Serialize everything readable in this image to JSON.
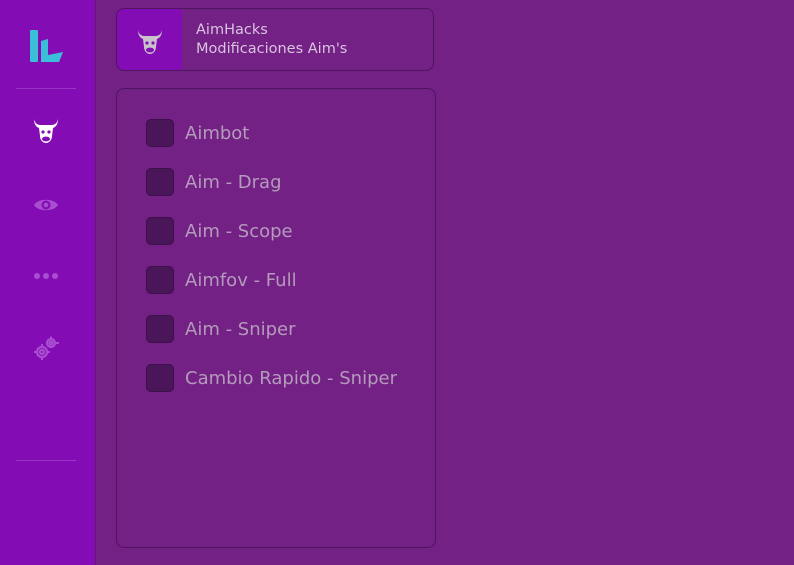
{
  "colors": {
    "sidebar_bg": "#830cb4",
    "content_bg": "#742186",
    "checkbox_bg": "#4a1559",
    "logo_accent": "#3bbfd8",
    "text_muted": "#b49bbb"
  },
  "sidebar": {
    "logo_icon": "brand-logo-icon",
    "items": [
      {
        "icon": "bull-icon",
        "active": true
      },
      {
        "icon": "eye-icon",
        "active": false
      },
      {
        "icon": "more-dots-icon",
        "active": false
      },
      {
        "icon": "gears-icon",
        "active": false
      }
    ]
  },
  "header": {
    "icon": "bull-icon",
    "title": "AimHacks",
    "subtitle": "Modificaciones Aim's"
  },
  "options": [
    {
      "label": "Aimbot",
      "checked": false
    },
    {
      "label": "Aim - Drag",
      "checked": false
    },
    {
      "label": "Aim - Scope",
      "checked": false
    },
    {
      "label": "Aimfov - Full",
      "checked": false
    },
    {
      "label": "Aim - Sniper",
      "checked": false
    },
    {
      "label": "Cambio Rapido - Sniper",
      "checked": false
    }
  ]
}
